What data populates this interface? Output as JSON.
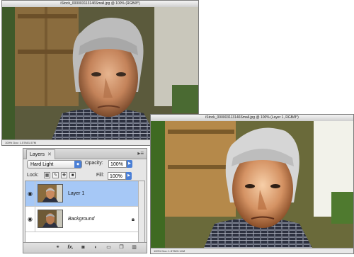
{
  "window1": {
    "title": "iStock_000003113146Small.jpg @ 100% (RGB/8*)",
    "status": "100%    Doc: 1.57M/1.57M"
  },
  "window2": {
    "title": "iStock_000003113146Small.jpg @ 100% (Layer 1, RGB/8*)",
    "status": "100%    Doc: 1.57M/3.14M"
  },
  "layers_panel": {
    "tab_label": "Layers",
    "tab_close": "✕",
    "menu_icon": "▸≡",
    "blend_mode": "Hard Light",
    "opacity_label": "Opacity:",
    "opacity_value": "100%",
    "lock_label": "Lock:",
    "fill_label": "Fill:",
    "fill_value": "100%",
    "layers": [
      {
        "name": "Layer 1",
        "selected": true,
        "visible": true
      },
      {
        "name": "Background",
        "selected": false,
        "visible": true,
        "locked": true
      }
    ],
    "bottom_icons": [
      "link-icon",
      "fx-icon",
      "mask-icon",
      "adjustment-icon",
      "group-folder-icon",
      "new-layer-icon",
      "trash-icon"
    ],
    "bottom_fx_text": "fx."
  },
  "colors": {
    "selection": "#a6c8f6",
    "accent_blue": "#4a7fd6"
  }
}
